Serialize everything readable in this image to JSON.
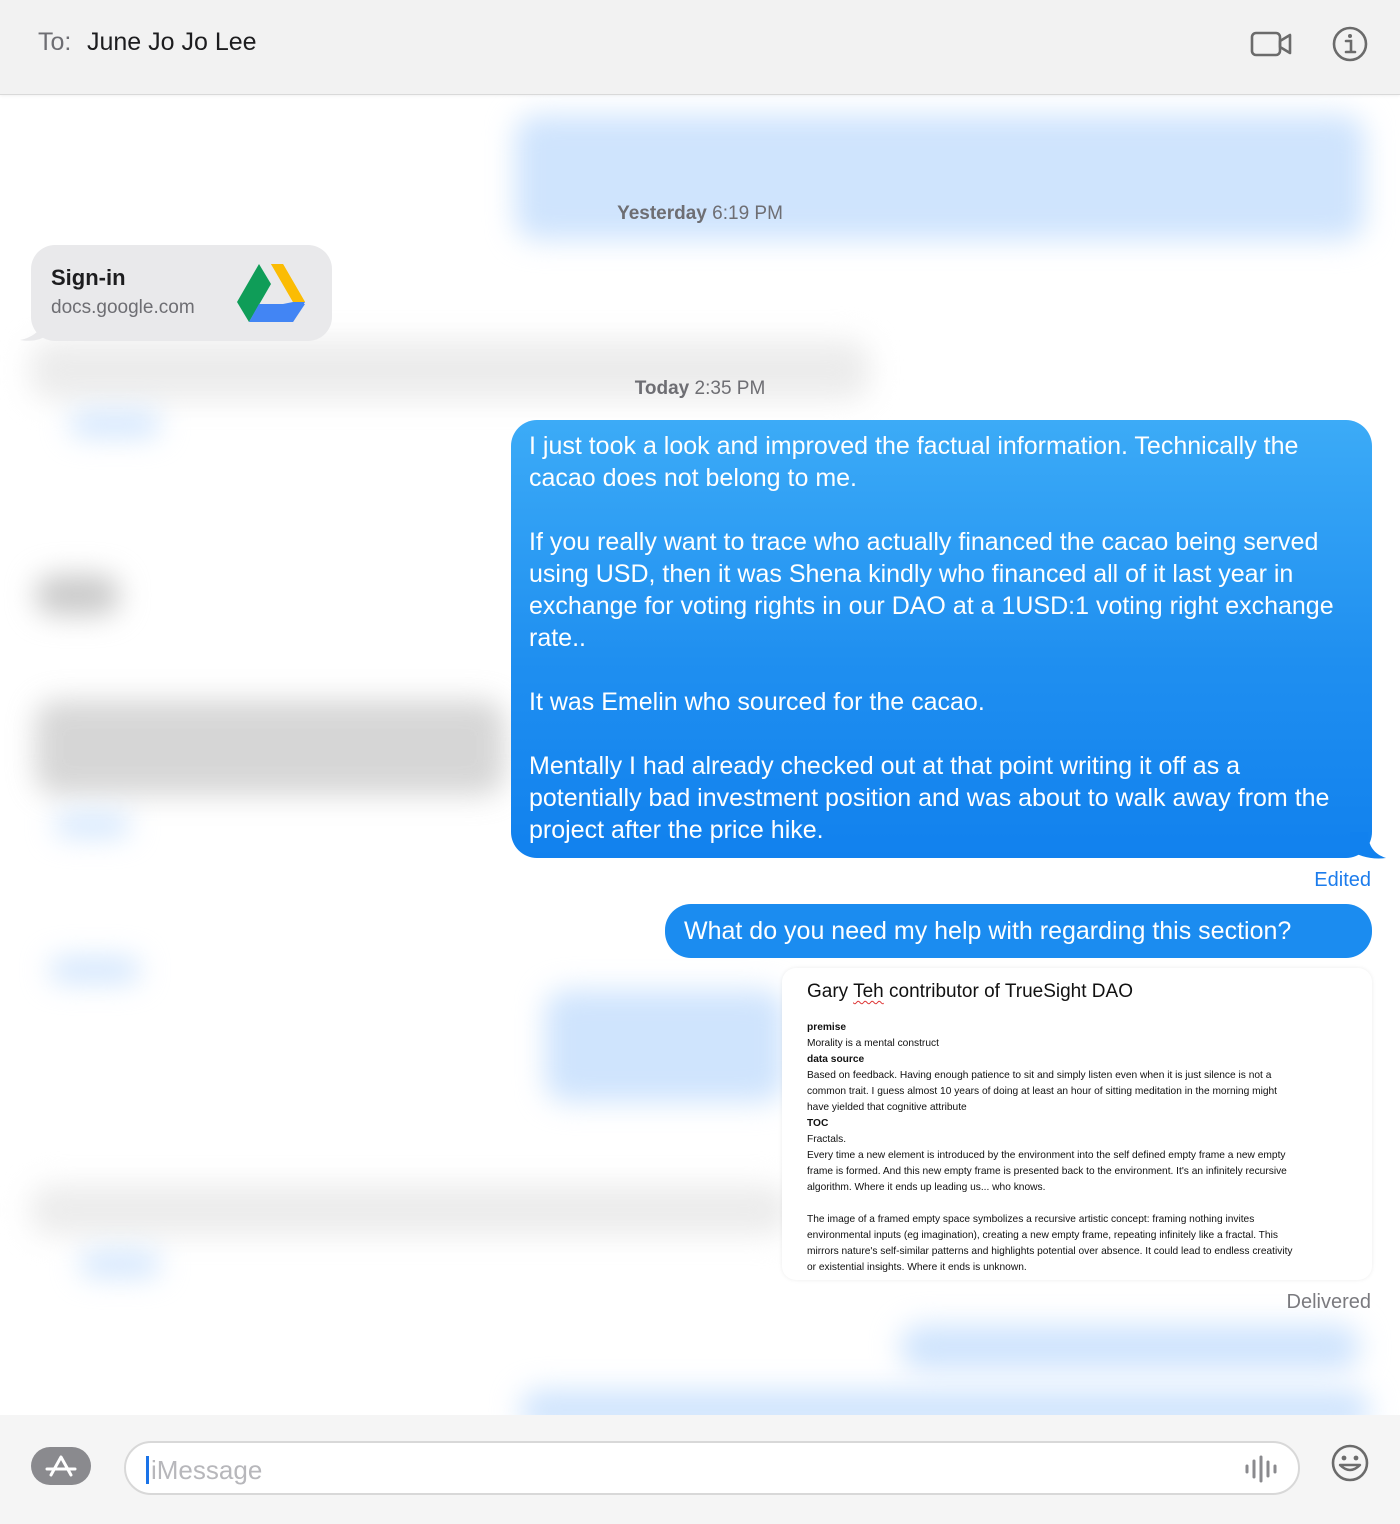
{
  "header": {
    "to_label": "To:",
    "recipient": "June Jo Jo Lee"
  },
  "transcript": {
    "timestamp_yesterday": {
      "day": "Yesterday",
      "time": "6:19 PM"
    },
    "link_preview": {
      "title": "Sign-in",
      "url": "docs.google.com"
    },
    "timestamp_today": {
      "day": "Today",
      "time": "2:35 PM"
    },
    "main_message": {
      "paragraphs": [
        "I just took a look and improved the factual information. Technically the cacao does not belong to me.",
        "If you really want to trace who actually financed the cacao being served using USD, then it was Shena kindly who financed all of it last year in exchange for voting rights in our DAO at a 1USD:1 voting right exchange rate..",
        "It was Emelin who sourced for the cacao.",
        "Mentally I had already checked out at that point writing it off as a potentially bad investment position and was about to walk away from the project after the price hike."
      ],
      "status": "Edited"
    },
    "question_message": "What do you need my help with regarding this section?",
    "attachment": {
      "title_prefix": "Gary ",
      "title_underlined": "Teh",
      "title_suffix": " contributor of TrueSight DAO",
      "lines": [
        "premise",
        "Morality is a mental construct",
        "data source",
        "Based on feedback. Having enough patience to sit and simply listen even when it is just silence is not a",
        "common trait. I guess almost 10 years of doing at least an hour of sitting meditation in the morning might",
        "have yielded that cognitive attribute",
        "TOC",
        "Fractals.",
        "Every time a new element is introduced by the environment into the self defined empty frame a new empty",
        "frame is formed. And this new empty frame is presented back to the environment. It's an infinitely recursive",
        "algorithm. Where it ends up leading us... who knows.",
        "The image of a framed empty space symbolizes a recursive artistic concept: framing nothing invites",
        "environmental inputs (eg imagination), creating a new empty frame, repeating infinitely like a fractal. This",
        "mirrors nature's self-similar patterns and highlights potential over absence. It could lead to endless creativity",
        "or existential insights. Where it ends is unknown."
      ]
    },
    "delivery_status": "Delivered"
  },
  "composer": {
    "placeholder": "iMessage"
  },
  "colors": {
    "sent_bubble": "#1b8cf0",
    "received_bubble": "#e9e9eb",
    "edited_link": "#1c7cec"
  },
  "icons": [
    "video-call-icon",
    "info-icon",
    "google-drive-icon",
    "app-store-icon",
    "audio-waveform-icon",
    "emoji-icon"
  ]
}
